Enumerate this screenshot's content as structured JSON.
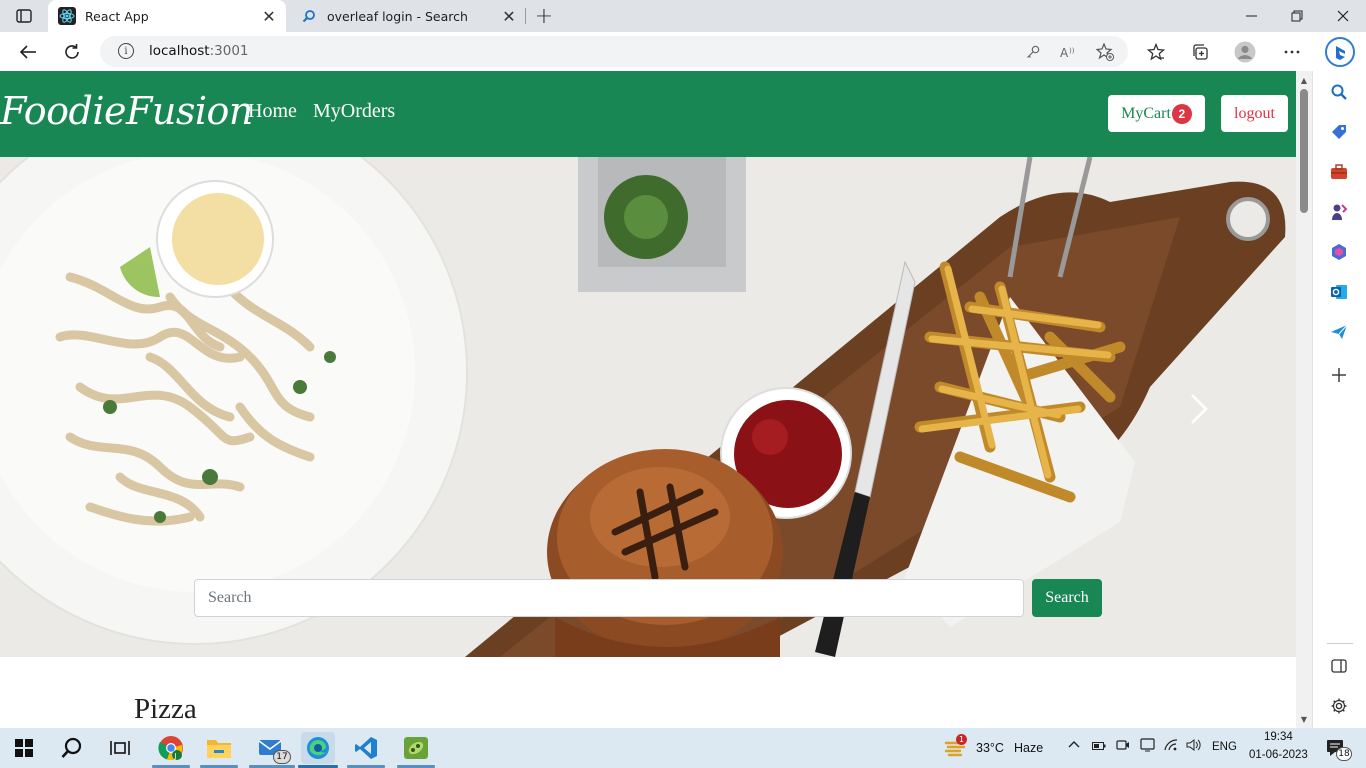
{
  "browser": {
    "tabs": [
      {
        "title": "React App",
        "active": true,
        "icon": "react-icon"
      },
      {
        "title": "overleaf login - Search",
        "active": false,
        "icon": "search-icon"
      }
    ],
    "url_host": "localhost",
    "url_port": ":3001",
    "close_glyph": "✕",
    "new_tab_glyph": "+"
  },
  "navbar": {
    "brand": "FoodieFusion",
    "links": [
      "Home",
      "MyOrders"
    ],
    "cart_label": "MyCart",
    "cart_count": "2",
    "logout_label": "logout"
  },
  "hero": {
    "search_placeholder": "Search",
    "search_button": "Search"
  },
  "content": {
    "first_category": "Pizza"
  },
  "taskbar": {
    "mail_badge": "17",
    "weather_badge": "1",
    "temperature": "33°C",
    "weather": "Haze",
    "language": "ENG",
    "time": "19:34",
    "date": "01-06-2023",
    "notifications": "18"
  },
  "colors": {
    "brand_green": "#198754",
    "danger_red": "#dc3545"
  }
}
